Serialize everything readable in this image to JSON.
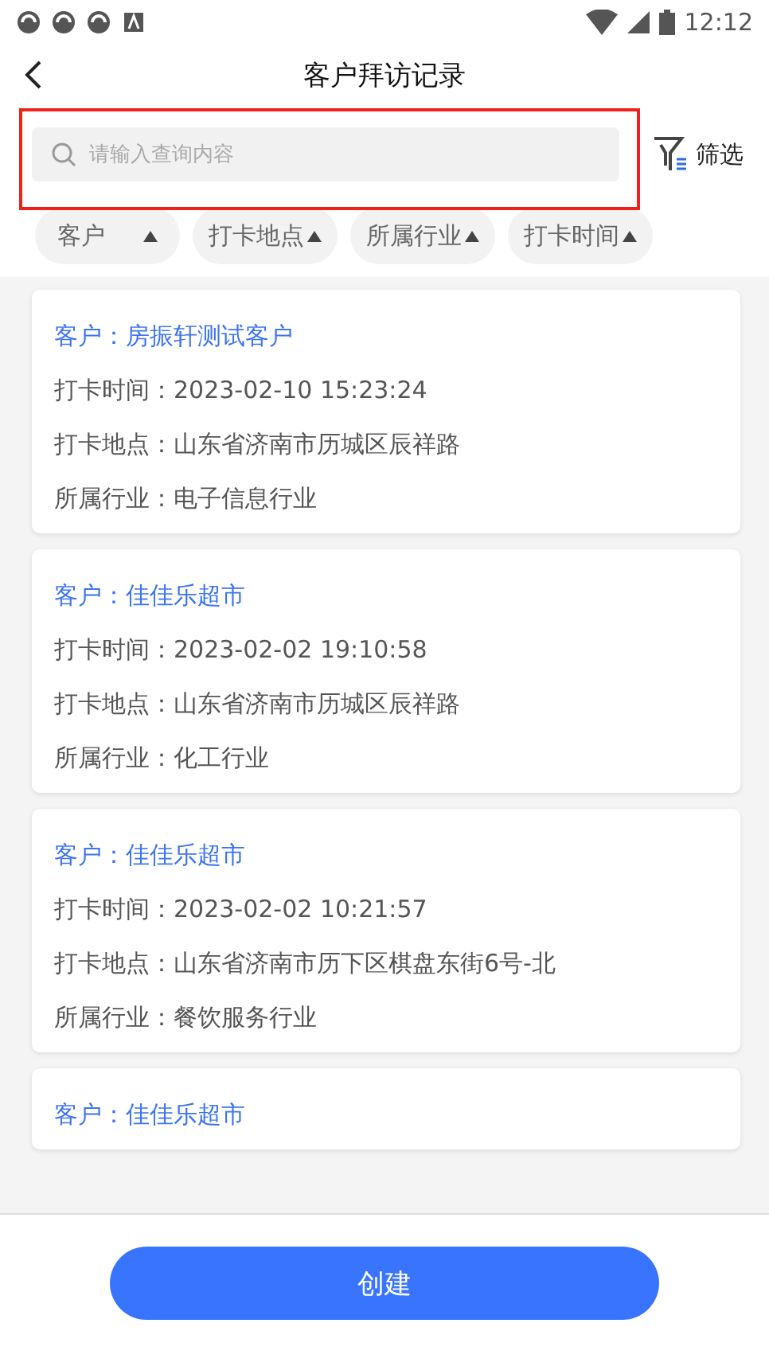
{
  "status_bar": {
    "time": "12:12"
  },
  "header": {
    "title": "客户拜访记录"
  },
  "search": {
    "placeholder": "请输入查询内容",
    "highlighted": true
  },
  "filter": {
    "label": "筛选"
  },
  "sort_options": [
    {
      "label": "客户"
    },
    {
      "label": "打卡地点"
    },
    {
      "label": "所属行业"
    },
    {
      "label": "打卡时间"
    }
  ],
  "records": [
    {
      "customer": "客户：房振轩测试客户",
      "fields": [
        "打卡时间：2023-02-10 15:23:24",
        "打卡地点：山东省济南市历城区辰祥路",
        "所属行业：电子信息行业"
      ]
    },
    {
      "customer": "客户：佳佳乐超市",
      "fields": [
        "打卡时间：2023-02-02 19:10:58",
        "打卡地点：山东省济南市历城区辰祥路",
        "所属行业：化工行业"
      ]
    },
    {
      "customer": "客户：佳佳乐超市",
      "fields": [
        "打卡时间：2023-02-02 10:21:57",
        "打卡地点：山东省济南市历下区棋盘东街6号-北",
        "所属行业：餐饮服务行业"
      ]
    },
    {
      "customer": "客户：佳佳乐超市"
    }
  ],
  "create_button": {
    "label": "创建"
  }
}
